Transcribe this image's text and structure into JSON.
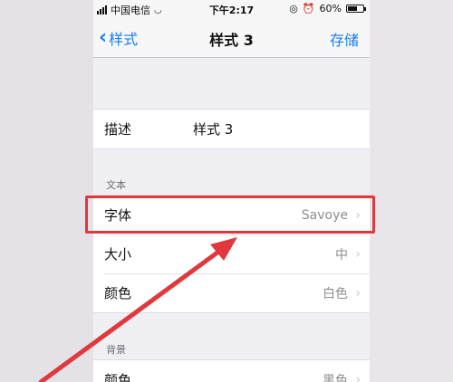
{
  "status": {
    "carrier": "中国电信",
    "time": "下午2:17",
    "battery": "60%"
  },
  "nav": {
    "back_label": "样式",
    "title": "样式 3",
    "save_label": "存储"
  },
  "description_row": {
    "label": "描述",
    "value": "样式 3"
  },
  "text_section": {
    "header": "文本",
    "rows": [
      {
        "label": "字体",
        "value": "Savoye"
      },
      {
        "label": "大小",
        "value": "中"
      },
      {
        "label": "颜色",
        "value": "白色"
      }
    ]
  },
  "background_section": {
    "header": "背景",
    "rows": [
      {
        "label": "颜色",
        "value": "黑色"
      }
    ]
  },
  "colors": {
    "accent": "#1a7ef6",
    "highlight": "#e0393d"
  }
}
